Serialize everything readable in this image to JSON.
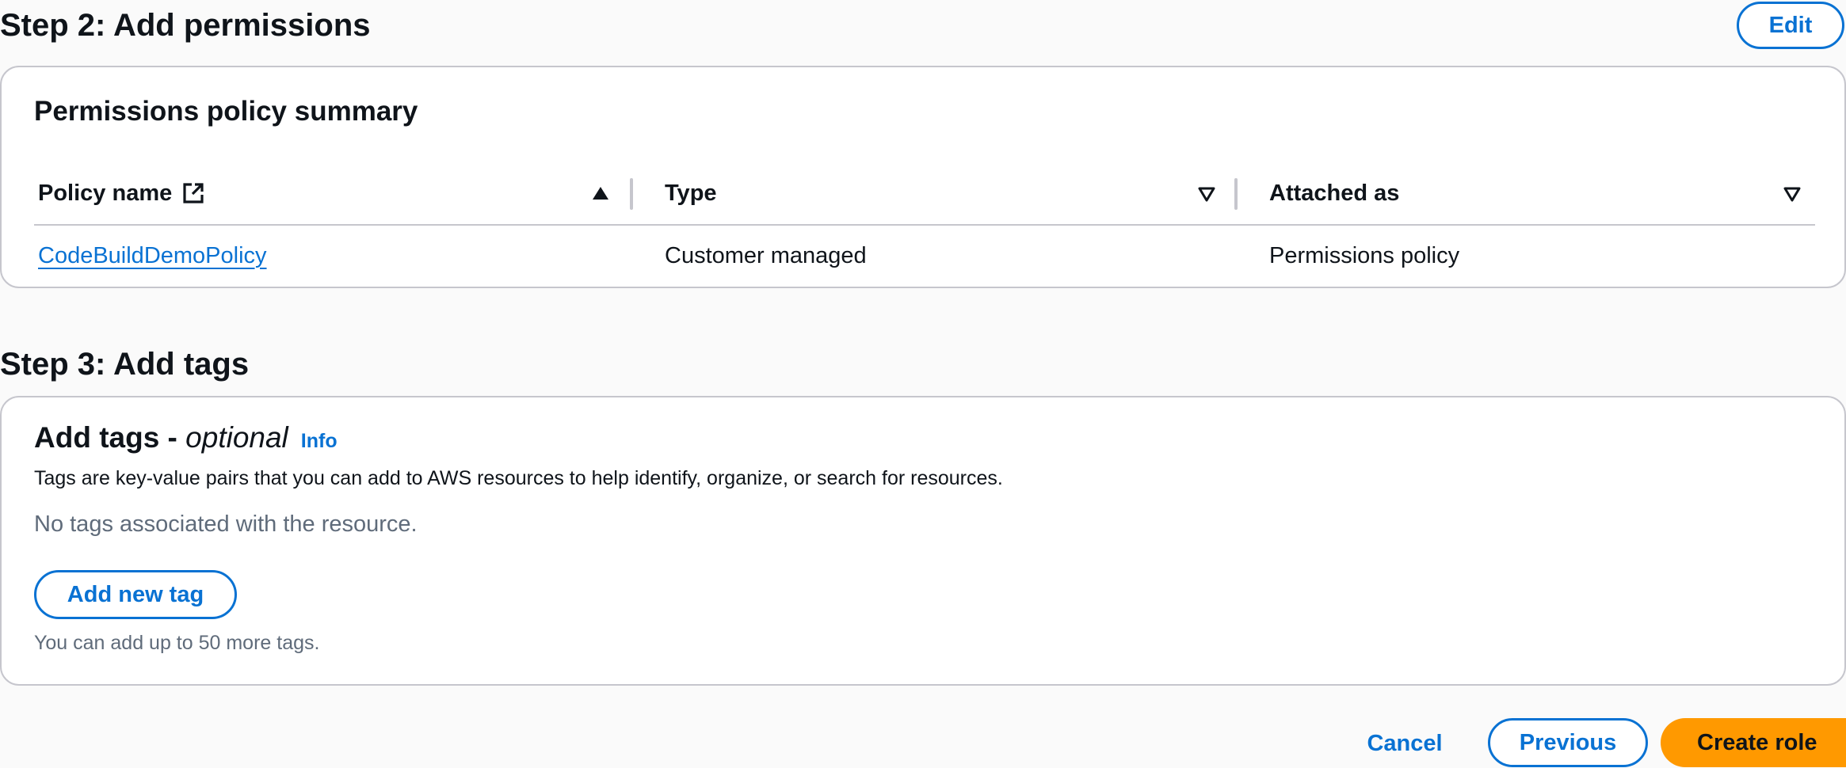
{
  "step2": {
    "title": "Step 2: Add permissions",
    "edit_label": "Edit",
    "container_title": "Permissions policy summary",
    "table": {
      "columns": [
        {
          "label": "Policy name",
          "sort": "ascending",
          "icon": "external-link-icon"
        },
        {
          "label": "Type",
          "sort": "none"
        },
        {
          "label": "Attached as",
          "sort": "none"
        }
      ],
      "rows": [
        {
          "policy_name": "CodeBuildDemoPolicy",
          "type": "Customer managed",
          "attached_as": "Permissions policy"
        }
      ]
    }
  },
  "step3": {
    "title": "Step 3: Add tags",
    "container_title": "Add tags - ",
    "container_title_optional": "optional",
    "info_label": "Info",
    "description": "Tags are key-value pairs that you can add to AWS resources to help identify, organize, or search for resources.",
    "empty_text": "No tags associated with the resource.",
    "add_tag_label": "Add new tag",
    "limit_text": "You can add up to 50 more tags."
  },
  "footer": {
    "cancel_label": "Cancel",
    "previous_label": "Previous",
    "create_label": "Create role"
  },
  "colors": {
    "link": "#0972d3",
    "primary_button": "#ff9900",
    "border": "#c6c6cd",
    "text": "#0f141a",
    "secondary_text": "#5f6b7a",
    "background": "#fafafa"
  }
}
